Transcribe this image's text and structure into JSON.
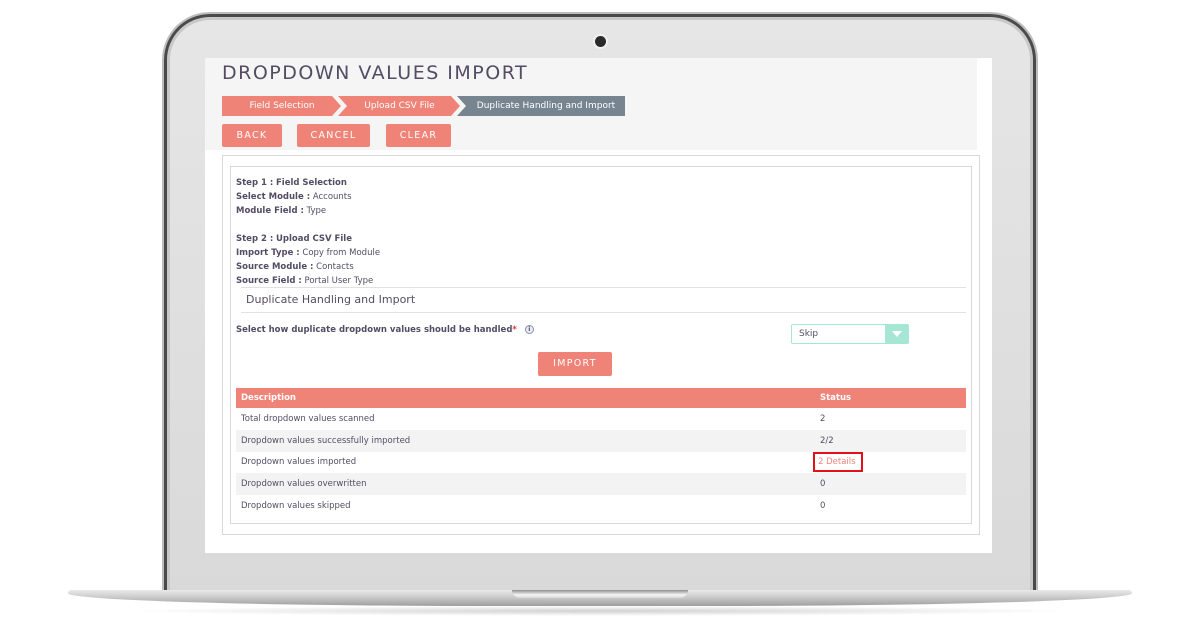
{
  "page": {
    "title": "DROPDOWN VALUES IMPORT"
  },
  "wizard": {
    "steps": [
      {
        "label": "Field Selection",
        "state": "done"
      },
      {
        "label": "Upload CSV File",
        "state": "done"
      },
      {
        "label": "Duplicate Handling and Import",
        "state": "active"
      }
    ]
  },
  "toolbar": {
    "back_label": "BACK",
    "cancel_label": "CANCEL",
    "clear_label": "CLEAR"
  },
  "summary": {
    "step1": {
      "heading_key": "Step 1 :",
      "heading_value": "Field Selection",
      "rows": [
        {
          "key": "Select Module :",
          "value": "Accounts"
        },
        {
          "key": "Module Field :",
          "value": "Type"
        }
      ]
    },
    "step2": {
      "heading_key": "Step 2 :",
      "heading_value": "Upload CSV File",
      "rows": [
        {
          "key": "Import Type :",
          "value": "Copy from Module"
        },
        {
          "key": "Source Module :",
          "value": "Contacts"
        },
        {
          "key": "Source Field :",
          "value": "Portal User Type"
        }
      ]
    }
  },
  "duplicate_handling": {
    "section_title": "Duplicate Handling and Import",
    "label": "Select how duplicate dropdown values should be handled",
    "required_mark": "*",
    "info_icon": "info-icon",
    "info_glyph": "i",
    "select_value": "Skip",
    "import_label": "IMPORT"
  },
  "results": {
    "columns": [
      "Description",
      "Status"
    ],
    "rows": [
      {
        "description": "Total dropdown values scanned",
        "status": "2"
      },
      {
        "description": "Dropdown values successfully imported",
        "status": "2/2"
      },
      {
        "description": "Dropdown values imported",
        "status": "2 Details",
        "is_link": true
      },
      {
        "description": "Dropdown values overwritten",
        "status": "0"
      },
      {
        "description": "Dropdown values skipped",
        "status": "0"
      }
    ]
  },
  "colors": {
    "accent": "#f08377",
    "step_active": "#778591",
    "select_accent": "#a6e6d5",
    "highlight_box": "#e3101a",
    "text": "#534d64"
  }
}
